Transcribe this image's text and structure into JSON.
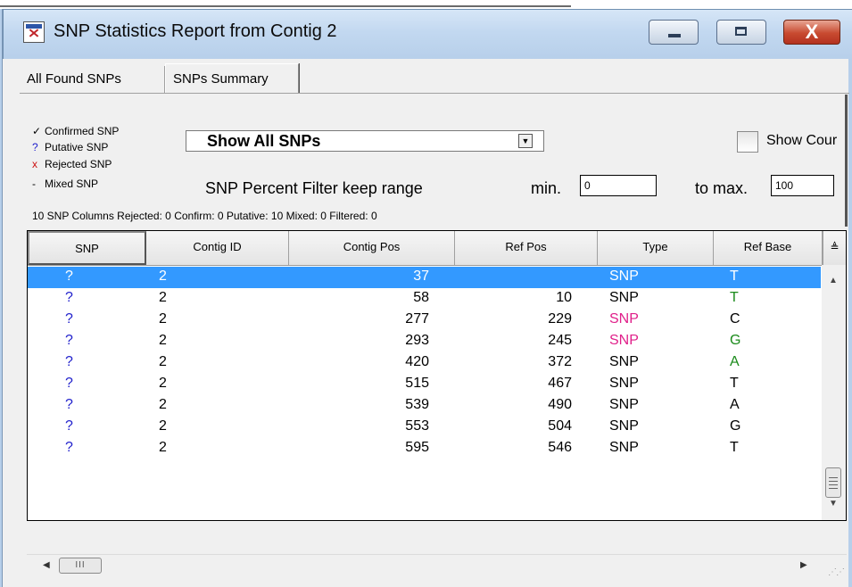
{
  "window": {
    "title": "SNP Statistics Report from Contig 2",
    "close_glyph": "X"
  },
  "tabs": [
    {
      "label": "All Found SNPs",
      "active": false
    },
    {
      "label": "SNPs Summary",
      "active": true
    }
  ],
  "legend": {
    "confirmed": {
      "symbol": "✓",
      "label": "Confirmed SNP"
    },
    "putative": {
      "symbol": "?",
      "label": "Putative SNP"
    },
    "rejected": {
      "symbol": "x",
      "label": "Rejected SNP"
    },
    "mixed": {
      "symbol": "-",
      "label": "Mixed SNP"
    }
  },
  "filter": {
    "show_select_value": "Show All SNPs",
    "show_counts_label": "Show Cour",
    "show_counts_checked": false,
    "percent_filter_label": "SNP Percent Filter  keep range",
    "min_label": "min.",
    "min_value": "0",
    "max_label": "to max.",
    "max_value": "100"
  },
  "status": "10 SNP Columns Rejected: 0 Confirm: 0 Putative: 10 Mixed: 0 Filtered: 0",
  "table": {
    "columns": [
      "SNP",
      "Contig ID",
      "Contig Pos",
      "Ref Pos",
      "Type",
      "Ref Base"
    ],
    "sort_glyph": "≜",
    "rows": [
      {
        "snp": "?",
        "contig_id": "2",
        "contig_pos": "37",
        "ref_pos": "",
        "type": "SNP",
        "ref_base": "T",
        "selected": true,
        "type_color": "#ffffff",
        "base_color": "#ffffff"
      },
      {
        "snp": "?",
        "contig_id": "2",
        "contig_pos": "58",
        "ref_pos": "10",
        "type": "SNP",
        "ref_base": "T",
        "selected": false,
        "type_color": "#000000",
        "base_color": "#1a8a1a"
      },
      {
        "snp": "?",
        "contig_id": "2",
        "contig_pos": "277",
        "ref_pos": "229",
        "type": "SNP",
        "ref_base": "C",
        "selected": false,
        "type_color": "#e0208a",
        "base_color": "#000000"
      },
      {
        "snp": "?",
        "contig_id": "2",
        "contig_pos": "293",
        "ref_pos": "245",
        "type": "SNP",
        "ref_base": "G",
        "selected": false,
        "type_color": "#e0208a",
        "base_color": "#1a8a1a"
      },
      {
        "snp": "?",
        "contig_id": "2",
        "contig_pos": "420",
        "ref_pos": "372",
        "type": "SNP",
        "ref_base": "A",
        "selected": false,
        "type_color": "#000000",
        "base_color": "#1a8a1a"
      },
      {
        "snp": "?",
        "contig_id": "2",
        "contig_pos": "515",
        "ref_pos": "467",
        "type": "SNP",
        "ref_base": "T",
        "selected": false,
        "type_color": "#000000",
        "base_color": "#000000"
      },
      {
        "snp": "?",
        "contig_id": "2",
        "contig_pos": "539",
        "ref_pos": "490",
        "type": "SNP",
        "ref_base": "A",
        "selected": false,
        "type_color": "#000000",
        "base_color": "#000000"
      },
      {
        "snp": "?",
        "contig_id": "2",
        "contig_pos": "553",
        "ref_pos": "504",
        "type": "SNP",
        "ref_base": "G",
        "selected": false,
        "type_color": "#000000",
        "base_color": "#000000"
      },
      {
        "snp": "?",
        "contig_id": "2",
        "contig_pos": "595",
        "ref_pos": "546",
        "type": "SNP",
        "ref_base": "T",
        "selected": false,
        "type_color": "#000000",
        "base_color": "#000000"
      }
    ]
  },
  "scroll": {
    "h_thumb_glyph": "III"
  },
  "colors": {
    "selection": "#3399ff",
    "putative_symbol": "#2222cc",
    "rejected_symbol": "#cc1111",
    "type_highlight": "#e0208a",
    "base_green": "#1a8a1a"
  }
}
